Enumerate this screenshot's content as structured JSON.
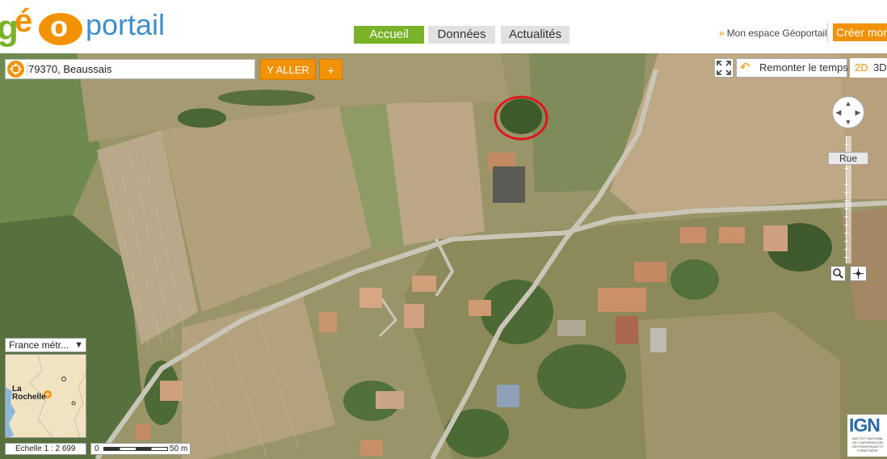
{
  "header": {
    "logo": {
      "g": "g",
      "e": "é",
      "o": "o",
      "portail": "portail"
    },
    "tabs": [
      {
        "label": "Accueil",
        "active": true
      },
      {
        "label": "Données",
        "active": false
      },
      {
        "label": "Actualités",
        "active": false
      }
    ],
    "account_link": "Mon espace Géoportail",
    "account_chevron": "»",
    "create_button": "Créer mon"
  },
  "map": {
    "search": {
      "value": "79370, Beaussais",
      "icon": "target-icon"
    },
    "go_button": "Y ALLER",
    "add_button": "+",
    "time_travel_button": "Remonter le temps",
    "view_2d": "2D",
    "view_3d": "3D",
    "zoom_level_label": "Rue",
    "region_select": "France métr...",
    "overview_city": "La Rochelle",
    "scale_label": "Echelle 1 :  2 699",
    "scale_zero": "0",
    "scale_max": "50 m",
    "ign": {
      "title": "IGN",
      "subtitle": "INSTITUT NATIONAL DE L'INFORMATION GÉOGRAPHIQUE ET FORESTIÈRE"
    }
  },
  "colors": {
    "brand_orange": "#f39200",
    "brand_green": "#7ab22a",
    "brand_blue": "#3d8ec9",
    "annotation_circle": "#e0151b"
  }
}
